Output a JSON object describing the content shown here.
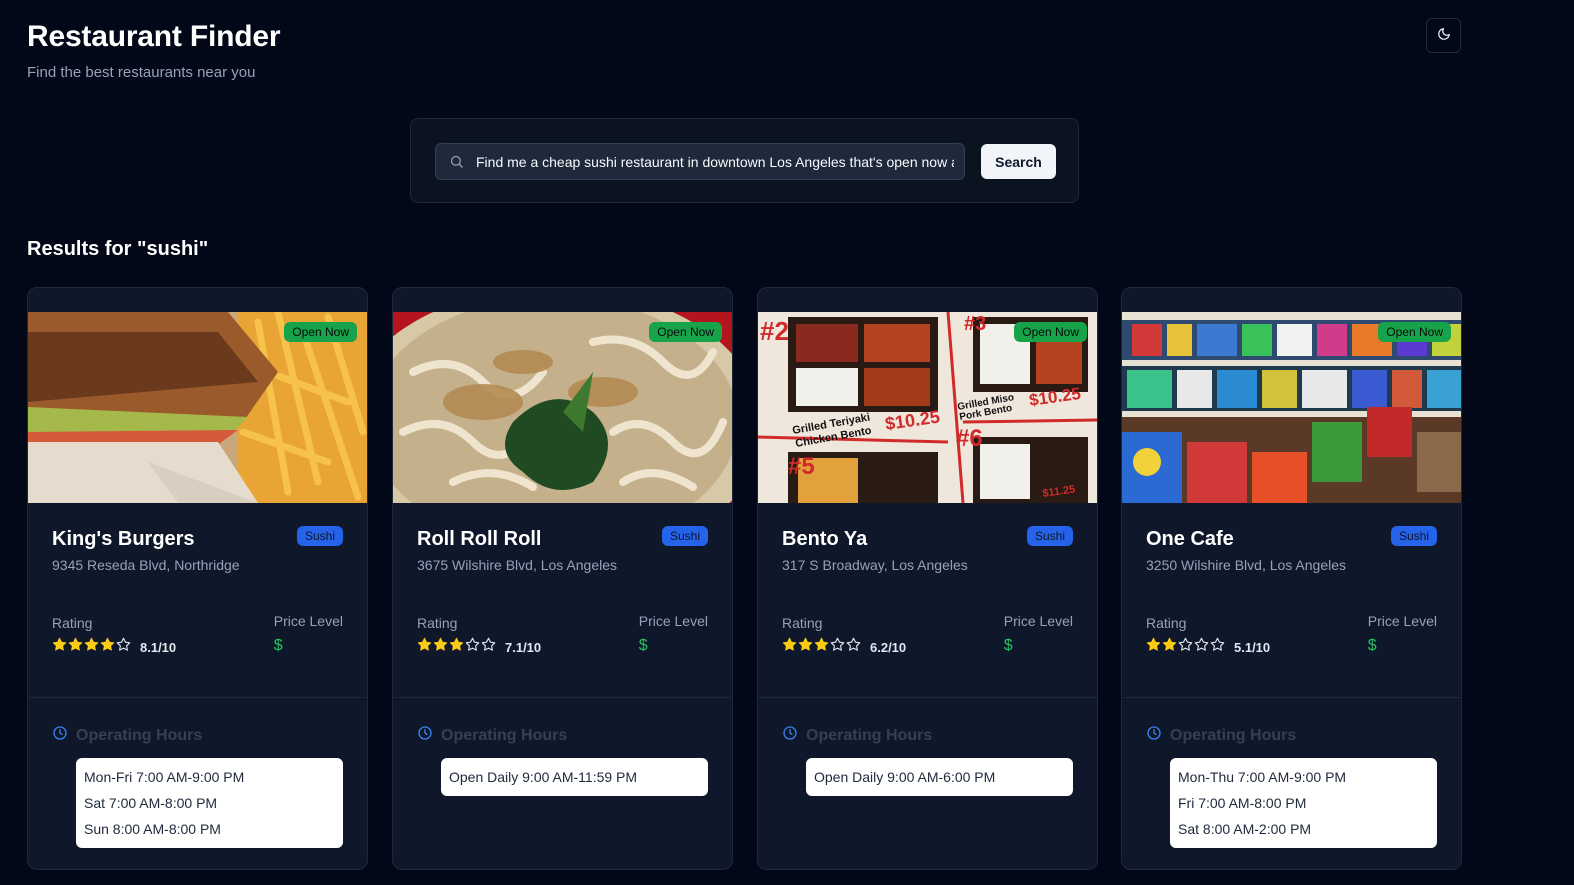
{
  "app": {
    "title": "Restaurant Finder",
    "subtitle": "Find the best restaurants near you",
    "theme_icon": "moon-icon"
  },
  "search": {
    "value": "Find me a cheap sushi restaurant in downtown Los Angeles that's open now a",
    "button_label": "Search"
  },
  "results": {
    "heading": "Results for \"sushi\"",
    "labels": {
      "rating": "Rating",
      "price": "Price Level",
      "hours": "Operating Hours"
    },
    "restaurants": [
      {
        "name": "King's Burgers",
        "address": "9345 Reseda Blvd, Northridge",
        "cuisine": "Sushi",
        "status": "Open Now",
        "stars": 4,
        "rating": "8.1/10",
        "price": "$",
        "image": "burger-and-fries-photo",
        "hours": [
          "Mon-Fri 7:00 AM-9:00 PM",
          "Sat 7:00 AM-8:00 PM",
          "Sun 8:00 AM-8:00 PM"
        ]
      },
      {
        "name": "Roll Roll Roll",
        "address": "3675 Wilshire Blvd, Los Angeles",
        "cuisine": "Sushi",
        "status": "Open Now",
        "stars": 3,
        "rating": "7.1/10",
        "price": "$",
        "image": "udon-soup-photo",
        "hours": [
          "Open Daily 9:00 AM-11:59 PM"
        ]
      },
      {
        "name": "Bento Ya",
        "address": "317 S Broadway, Los Angeles",
        "cuisine": "Sushi",
        "status": "Open Now",
        "stars": 3,
        "rating": "6.2/10",
        "price": "$",
        "image": "bento-menu-photo",
        "menu_text": [
          "#2",
          "#3",
          "#5",
          "#6",
          "Grilled Teriyaki",
          "Chicken Bento",
          "Grilled Miso",
          "Pork Bento",
          "$10.25",
          "$10.25",
          "$11.25"
        ],
        "hours": [
          "Open Daily 9:00 AM-6:00 PM"
        ]
      },
      {
        "name": "One Cafe",
        "address": "3250 Wilshire Blvd, Los Angeles",
        "cuisine": "Sushi",
        "status": "Open Now",
        "stars": 2,
        "rating": "5.1/10",
        "price": "$",
        "image": "snack-shelf-photo",
        "hours": [
          "Mon-Thu 7:00 AM-9:00 PM",
          "Fri 7:00 AM-8:00 PM",
          "Sat 8:00 AM-2:00 PM"
        ]
      }
    ]
  },
  "colors": {
    "background": "#020817",
    "card": "#0f172a",
    "open_badge": "#16a34a",
    "cuisine_badge": "#2563eb",
    "star": "#facc15",
    "price": "#22c55e"
  }
}
